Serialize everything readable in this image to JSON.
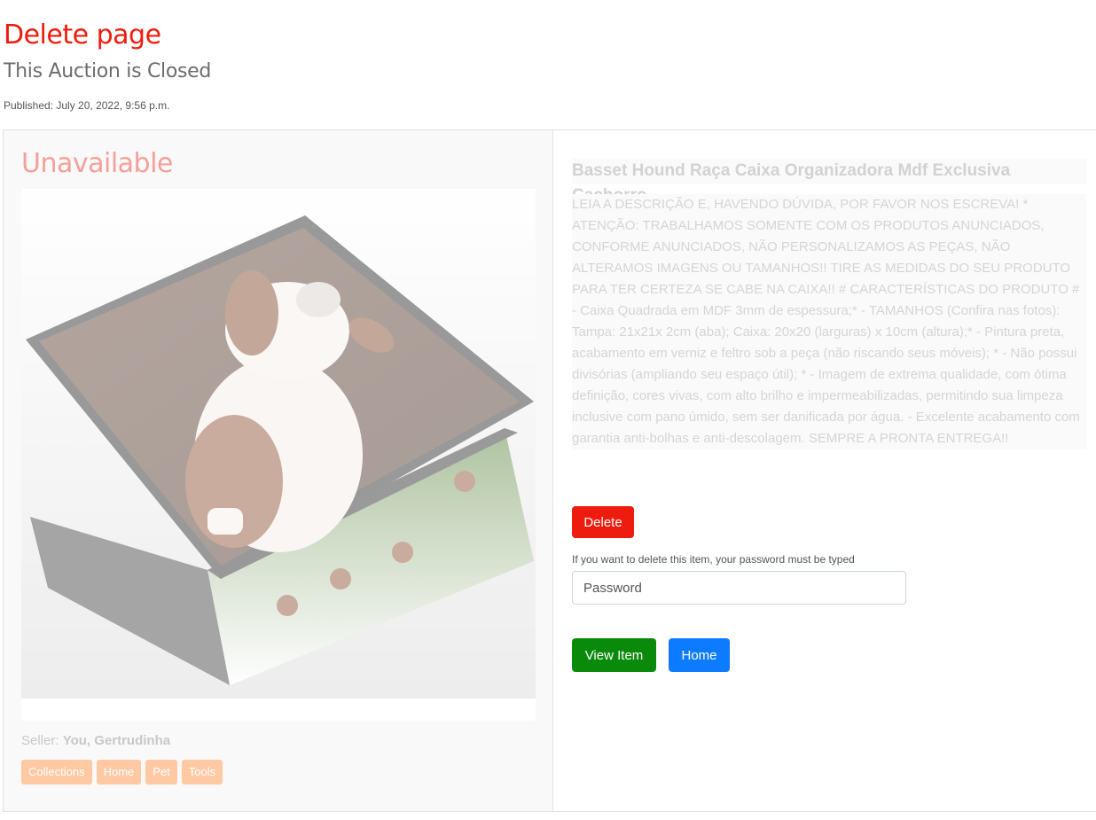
{
  "header": {
    "title": "Delete page",
    "subtitle": "This Auction is Closed",
    "published": "Published: July 20, 2022, 9:56 p.m."
  },
  "listing": {
    "status": "Unavailable",
    "image_alt": "Basset hound printed storage box",
    "seller_label": "Seller:",
    "seller_name": "You, Gertrudinha",
    "tags": [
      "Collections",
      "Home",
      "Pet",
      "Tools"
    ],
    "title": "Basset Hound Raça Caixa Organizadora Mdf Exclusiva Cachorro",
    "description": "LEIA A DESCRIÇÃO E, HAVENDO DÚVIDA, POR FAVOR NOS ESCREVA! * ATENÇÃO: TRABALHAMOS SOMENTE COM OS PRODUTOS ANUNCIADOS, CONFORME ANUNCIADOS, NÃO PERSONALIZAMOS AS PEÇAS, NÃO ALTERAMOS IMAGENS OU TAMANHOS!! TIRE AS MEDIDAS DO SEU PRODUTO PARA TER CERTEZA SE CABE NA CAIXA!! # CARACTERÍSTICAS DO PRODUTO # - Caixa Quadrada em MDF 3mm de espessura;* - TAMANHOS (Confira nas fotos): Tampa: 21x21x 2cm (aba); Caixa: 20x20 (larguras) x 10cm (altura);* - Pintura preta, acabamento em verniz e feltro sob a peça (não riscando seus móveis); * - Não possui divisórias (ampliando seu espaço útil); * - Imagem de extrema qualidade, com ótima definição, cores vivas, com alto brilho e impermeabilizadas, permitindo sua limpeza inclusive com pano úmido, sem ser danificada por água. - Excelente acabamento com garantia anti-bolhas e anti-descolagem. SEMPRE A PRONTA ENTREGA!!"
  },
  "actions": {
    "delete_label": "Delete",
    "password_help": "If you want to delete this item, your password must be typed",
    "password_placeholder": "Password",
    "view_item_label": "View Item",
    "home_label": "Home"
  },
  "colors": {
    "title_red": "#ee1c0e",
    "delete_red": "#ee1c0e",
    "view_green": "#0a8a0a",
    "home_blue": "#0d7bff",
    "tag_orange": "#ffc9a3"
  }
}
